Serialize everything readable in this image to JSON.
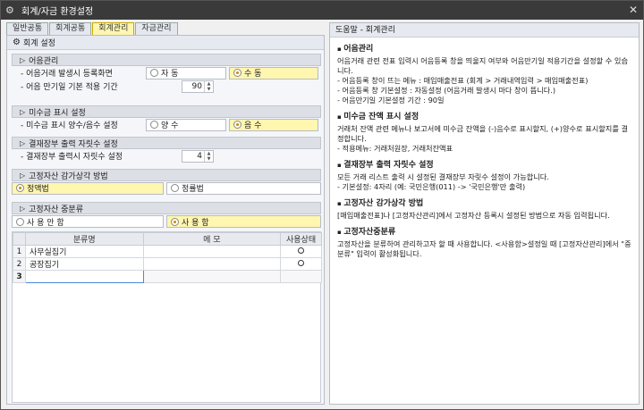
{
  "window": {
    "title": "회계/자금 환경설정",
    "close": "✕"
  },
  "tabs": [
    {
      "label": "일반공통"
    },
    {
      "label": "회계공통"
    },
    {
      "label": "회계관리"
    },
    {
      "label": "자금관리"
    }
  ],
  "left": {
    "header": "회계 설정",
    "s1": {
      "title": "어음관리",
      "r1_label": "- 어음거래 발생시 등록화면",
      "opt1": "자 동",
      "opt2": "수 동",
      "r2_label": "- 어음 만기일 기본 적용 기간",
      "r2_value": "90"
    },
    "s2": {
      "title": "미수금 표시 설정",
      "r1_label": "- 미수금 표시 양수/음수 설정",
      "opt1": "양 수",
      "opt2": "음 수"
    },
    "s3": {
      "title": "결재장부 출력 자릿수 설정",
      "r1_label": "- 결재장부 출력시 자릿수 설정",
      "r1_value": "4"
    },
    "s4": {
      "title": "고정자산 감가상각 방법",
      "opt1": "정액법",
      "opt2": "정률법"
    },
    "s5": {
      "title": "고정자산 중분류",
      "opt1": "사 용 안 함",
      "opt2": "사 용 함",
      "columns": [
        "분류명",
        "메 모",
        "사용상태"
      ],
      "rows": [
        {
          "num": "1",
          "name": "사무실집기",
          "memo": "",
          "status": "○"
        },
        {
          "num": "2",
          "name": "공장집기",
          "memo": "",
          "status": "○"
        },
        {
          "num": "3",
          "name": "",
          "memo": "",
          "status": ""
        }
      ]
    }
  },
  "help": {
    "header": "도움말 - 회계관리",
    "sections": [
      {
        "title": "어음관리",
        "lines": [
          "어음거래 관련 전표 입력시 어음등록 창을 띄울지 여부와 어음만기일 적용기간을 설정할 수 있습니다.",
          "- 어음등록 창이 뜨는 메뉴 : 매입매출전표 (회계 > 거래내역입력 > 매입매출전표)",
          "- 어음등록 창 기본설정 : 자동설정 (어음거래 발생시 마다 창이 뜹니다.)",
          "- 어음만기일 기본설정 기간 : 90일"
        ]
      },
      {
        "title": "미수금 잔액 표시 설정",
        "lines": [
          "거래처 잔액 관련 메뉴나 보고서에 미수금 잔액을 (-)음수로 표시할지, (+)양수로 표시할지를 결정합니다.",
          "- 적용메뉴: 거래처원장, 거래처잔액표"
        ]
      },
      {
        "title": "결재장부 출력 자릿수 설정",
        "lines": [
          "모든 거래 리스트 출력 시 설정된 결재장부 자릿수 설정이 가능합니다.",
          "- 기본설정: 4자리 (예: 국민은행(011) -> '국민은행'만 출력)"
        ]
      },
      {
        "title": "고정자산 감가상각 방법",
        "lines": [
          "[매입매출전표]나 [고정자산관리]에서 고정자산 등록시 설정된 방법으로 자동 입력됩니다."
        ]
      },
      {
        "title": "고정자산중분류",
        "lines": [
          "고정자산을 분류하여 관리하고자 할 때 사용합니다. <사용함>설정일 때 [고정자산관리]에서 \"중분류\" 입력이 활성화됩니다."
        ]
      }
    ]
  }
}
